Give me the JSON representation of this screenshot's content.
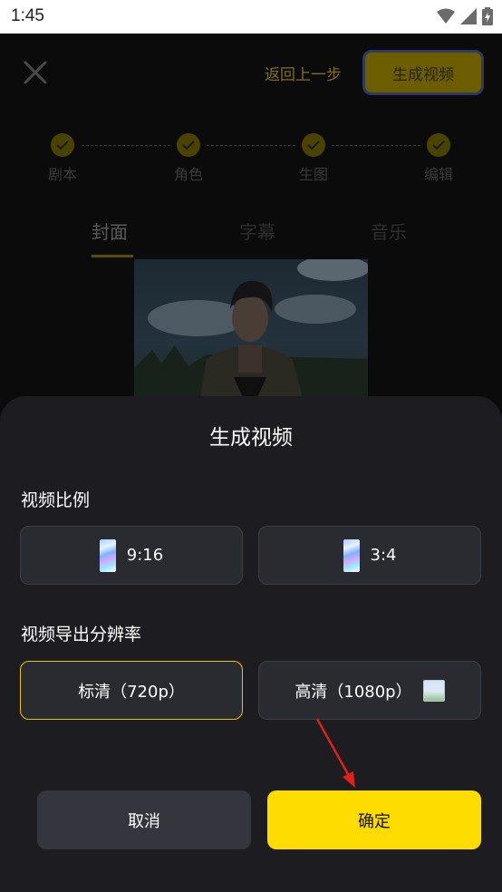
{
  "status_bar": {
    "time": "1:45"
  },
  "header": {
    "back_step_label": "返回上一步",
    "generate_label": "生成视频"
  },
  "steps": [
    {
      "label": "剧本"
    },
    {
      "label": "角色"
    },
    {
      "label": "生图"
    },
    {
      "label": "编辑"
    }
  ],
  "tabs": [
    {
      "label": "封面",
      "active": true
    },
    {
      "label": "字幕",
      "active": false
    },
    {
      "label": "音乐",
      "active": false
    }
  ],
  "sheet": {
    "title": "生成视频",
    "ratio_section": {
      "label": "视频比例",
      "options": [
        {
          "label": "9:16",
          "icon": "holographic-portrait-icon"
        },
        {
          "label": "3:4",
          "icon": "holographic-portrait-icon"
        }
      ]
    },
    "resolution_section": {
      "label": "视频导出分辨率",
      "options": [
        {
          "label": "标清（720p）",
          "selected": true
        },
        {
          "label": "高清（1080p）",
          "selected": false,
          "icon": "image-thumbnail-icon"
        }
      ]
    },
    "cancel_label": "取消",
    "confirm_label": "确定"
  },
  "colors": {
    "accent": "#ffdc00",
    "sheet_bg": "#1c1c21",
    "option_bg": "#2a2b31",
    "selected_border": "#e8c400",
    "annotation_arrow": "#e0201a"
  }
}
